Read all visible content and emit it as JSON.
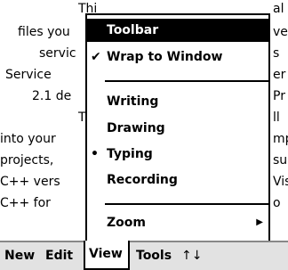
{
  "document": {
    "lines": [
      "Thi",
      "files you",
      "servic",
      "Service",
      "2.1 de",
      "T",
      "into your",
      "projects,",
      "C++ vers",
      "C++ for"
    ],
    "right_fragments": [
      "al",
      "ve",
      "s",
      "er",
      "Pr",
      "ll",
      "mp",
      "su",
      "Vis",
      "o"
    ]
  },
  "menubar": {
    "new": "New",
    "edit": "Edit",
    "view": "View",
    "tools": "Tools",
    "arrows_icon": "up-down-arrows-icon"
  },
  "view_menu": {
    "items": [
      {
        "label": "Toolbar",
        "mark": ""
      },
      {
        "label": "Wrap to Window",
        "mark": "✔"
      },
      {
        "label": "Writing",
        "mark": ""
      },
      {
        "label": "Drawing",
        "mark": ""
      },
      {
        "label": "Typing",
        "mark": "•"
      },
      {
        "label": "Recording",
        "mark": ""
      },
      {
        "label": "Zoom",
        "mark": ""
      }
    ],
    "submenu_icon": "submenu-arrow-icon"
  }
}
